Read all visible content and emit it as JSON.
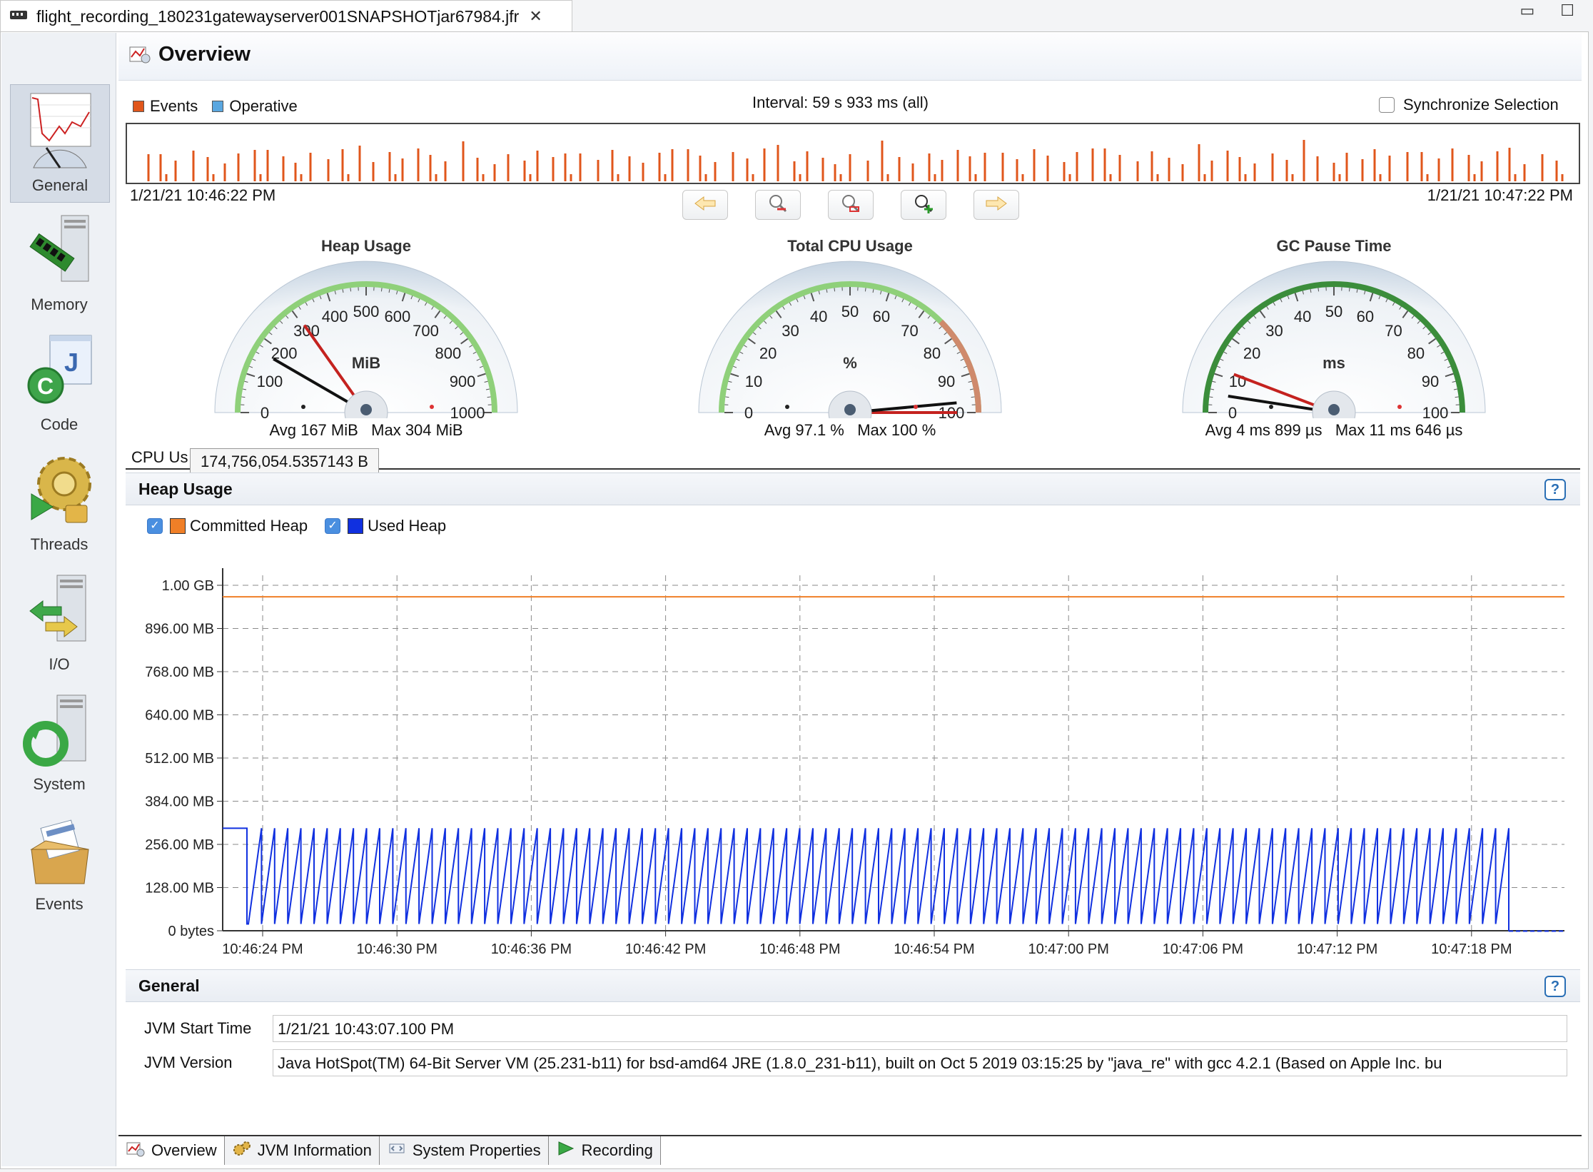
{
  "editor": {
    "tab_title": "flight_recording_180231gatewayserver001SNAPSHOTjar67984.jfr"
  },
  "nav": {
    "items": [
      {
        "label": "General",
        "icon": "general-gauge-icon"
      },
      {
        "label": "Memory",
        "icon": "memory-icon"
      },
      {
        "label": "Code",
        "icon": "code-icon"
      },
      {
        "label": "Threads",
        "icon": "threads-icon"
      },
      {
        "label": "I/O",
        "icon": "io-icon"
      },
      {
        "label": "System",
        "icon": "system-icon"
      },
      {
        "label": "Events",
        "icon": "events-icon"
      }
    ]
  },
  "page": {
    "title": "Overview"
  },
  "timeline": {
    "legend_events": "Events",
    "legend_operative": "Operative",
    "interval": "Interval: 59 s 933 ms (all)",
    "sync_label": "Synchronize Selection",
    "start": "1/21/21 10:46:22 PM",
    "end": "1/21/21 10:47:22 PM",
    "colors": {
      "events": "#e0561b",
      "operative": "#5aa7e0"
    }
  },
  "gauges": [
    {
      "title": "Heap Usage",
      "unit": "MiB",
      "ticks": [
        "0",
        "100",
        "200",
        "300",
        "400",
        "500",
        "600",
        "700",
        "800",
        "900",
        "1000"
      ],
      "avg": "Avg 167 MiB",
      "max": "Max 304 MiB",
      "avg_frac": 0.167,
      "max_frac": 0.304
    },
    {
      "title": "Total CPU Usage",
      "unit": "%",
      "ticks": [
        "0",
        "10",
        "20",
        "30",
        "40",
        "50",
        "60",
        "70",
        "80",
        "90",
        "100"
      ],
      "avg": "Avg 97.1 %",
      "max": "Max 100 %",
      "avg_frac": 0.971,
      "max_frac": 1.0
    },
    {
      "title": "GC Pause Time",
      "unit": "ms",
      "ticks": [
        "0",
        "10",
        "20",
        "30",
        "40",
        "50",
        "60",
        "70",
        "80",
        "90",
        "100"
      ],
      "avg": "Avg 4 ms 899 µs",
      "max": "Max 11 ms 646 µs",
      "avg_frac": 0.049,
      "max_frac": 0.116
    }
  ],
  "cpu_tab_label": "CPU Us",
  "tooltip": "174,756,054.5357143 B",
  "heap_section": {
    "title": "Heap Usage",
    "legend": [
      {
        "label": "Committed Heap",
        "color": "#f07f27"
      },
      {
        "label": "Used Heap",
        "color": "#1030e0"
      }
    ]
  },
  "chart_data": {
    "type": "line",
    "title": "Heap Usage",
    "y_ticks": [
      "0 bytes",
      "128.00 MB",
      "256.00 MB",
      "384.00 MB",
      "512.00 MB",
      "640.00 MB",
      "768.00 MB",
      "896.00 MB",
      "1.00 GB"
    ],
    "x_ticks": [
      "10:46:24 PM",
      "10:46:30 PM",
      "10:46:36 PM",
      "10:46:42 PM",
      "10:46:48 PM",
      "10:46:54 PM",
      "10:47:00 PM",
      "10:47:06 PM",
      "10:47:12 PM",
      "10:47:18 PM"
    ],
    "ylim_mb": [
      0,
      1024
    ],
    "grid": true,
    "series": [
      {
        "name": "Committed Heap",
        "color": "#f07f27",
        "value_mb": 990
      },
      {
        "name": "Used Heap",
        "color": "#1030e0",
        "min_mb": 20,
        "max_mb": 304,
        "sawtooth_cycles": 96
      }
    ]
  },
  "general": {
    "title": "General",
    "rows": [
      {
        "label": "JVM Start Time",
        "value": "1/21/21 10:43:07.100 PM"
      },
      {
        "label": "JVM Version",
        "value": "Java HotSpot(TM) 64-Bit Server VM (25.231-b11) for bsd-amd64 JRE (1.8.0_231-b11), built on Oct  5 2019 03:15:25 by \"java_re\" with gcc 4.2.1 (Based on Apple Inc. bu"
      }
    ]
  },
  "bottom_tabs": [
    {
      "label": "Overview",
      "icon": "overview-icon"
    },
    {
      "label": "JVM Information",
      "icon": "gears-icon"
    },
    {
      "label": "System Properties",
      "icon": "properties-icon"
    },
    {
      "label": "Recording",
      "icon": "play-icon"
    }
  ]
}
